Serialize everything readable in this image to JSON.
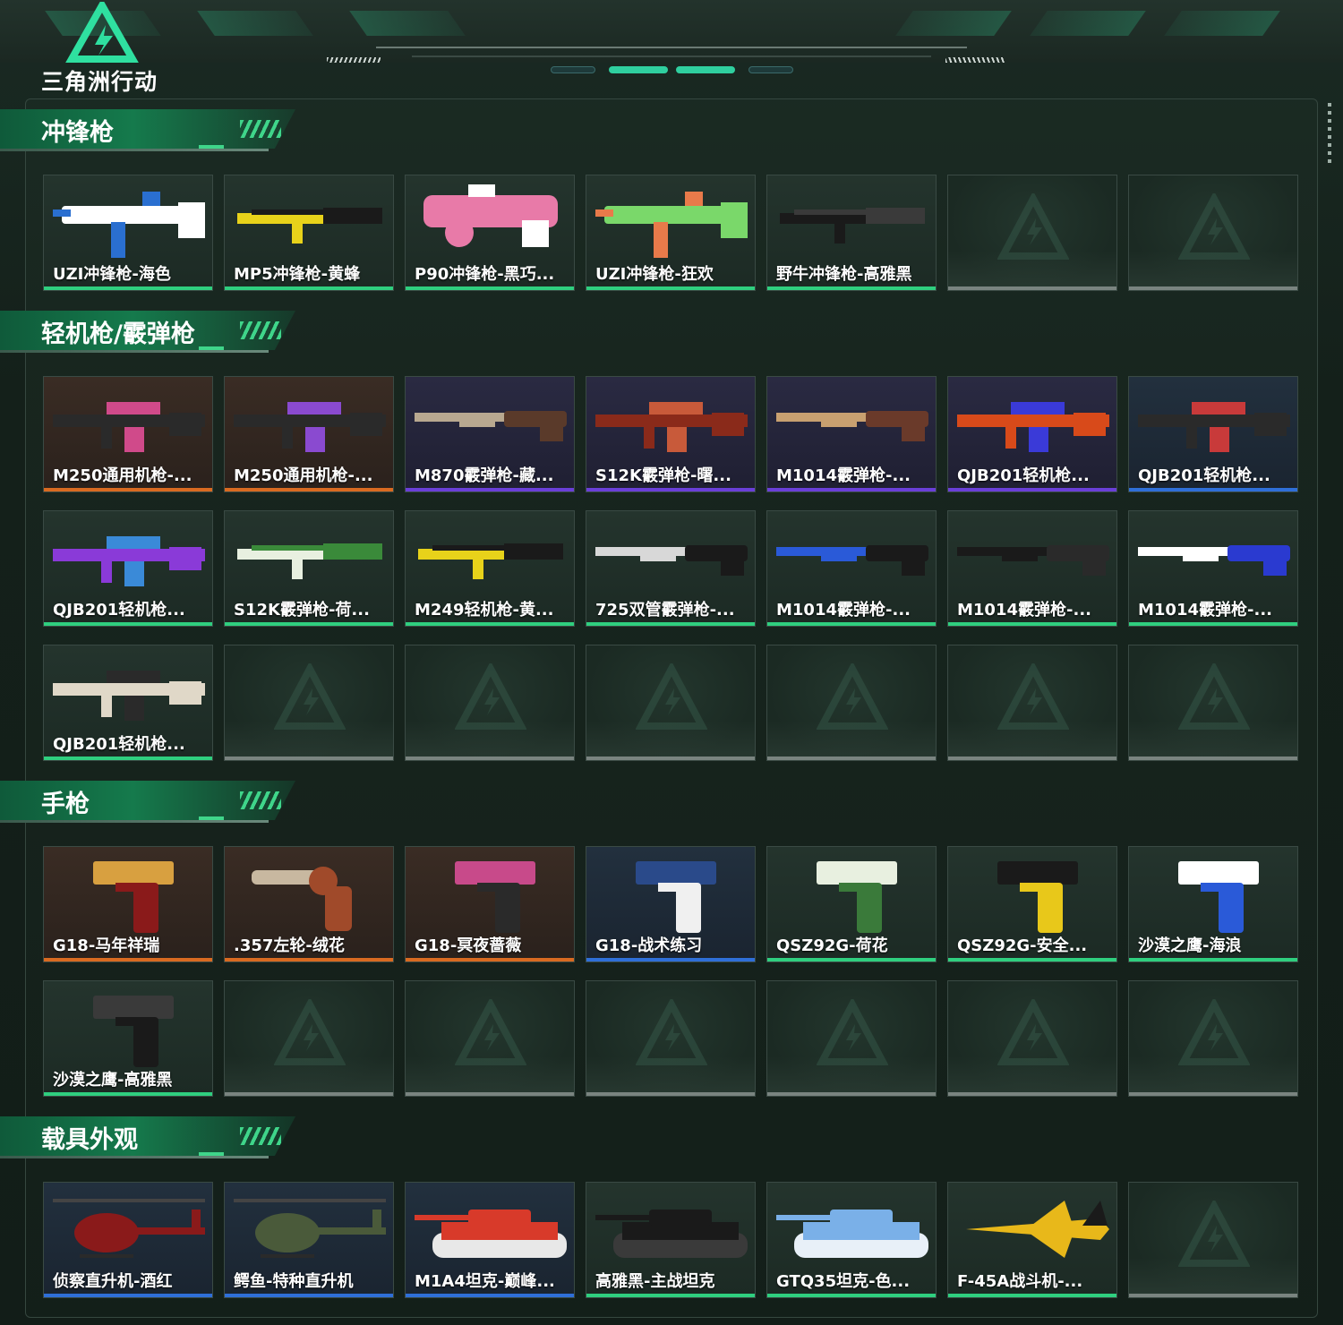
{
  "brand": {
    "logo_text": "三角洲行动",
    "accent": "#2fcf7f"
  },
  "rarity_colors": {
    "green": "#2fcf7f",
    "orange": "#d96a21",
    "purple": "#6a3fd8",
    "blue": "#2f6fd8",
    "empty": "#7a8480"
  },
  "sections": [
    {
      "title": "冲锋枪",
      "items": [
        {
          "label": "UZI冲锋枪-海色",
          "rarity": "green",
          "kind": "smg",
          "colors": [
            "#ffffff",
            "#2a6fd0"
          ]
        },
        {
          "label": "MP5冲锋枪-黄蜂",
          "rarity": "green",
          "kind": "rifle",
          "colors": [
            "#e8d21a",
            "#1a1a1a"
          ]
        },
        {
          "label": "P90冲锋枪-黑巧...",
          "rarity": "green",
          "kind": "p90",
          "colors": [
            "#e87aa8",
            "#ffffff"
          ]
        },
        {
          "label": "UZI冲锋枪-狂欢",
          "rarity": "green",
          "kind": "smg",
          "colors": [
            "#7ad86a",
            "#e87a4a"
          ]
        },
        {
          "label": "野牛冲锋枪-高雅黑",
          "rarity": "green",
          "kind": "rifle",
          "colors": [
            "#1a1a1a",
            "#3a3a3a"
          ]
        },
        {
          "label": "",
          "rarity": "empty"
        },
        {
          "label": "",
          "rarity": "empty"
        }
      ]
    },
    {
      "title": "轻机枪/霰弹枪",
      "items": [
        {
          "label": "M250通用机枪-...",
          "rarity": "orange",
          "kind": "lmg",
          "colors": [
            "#2a2a2a",
            "#d04a8a"
          ]
        },
        {
          "label": "M250通用机枪-...",
          "rarity": "orange",
          "kind": "lmg",
          "colors": [
            "#2a2a2a",
            "#8a4ad0"
          ]
        },
        {
          "label": "M870霰弹枪-藏...",
          "rarity": "purple",
          "kind": "shotgun",
          "colors": [
            "#b8a890",
            "#5a3a2a"
          ]
        },
        {
          "label": "S12K霰弹枪-曙...",
          "rarity": "purple",
          "kind": "lmg",
          "colors": [
            "#8a2a1a",
            "#c85a3a"
          ]
        },
        {
          "label": "M1014霰弹枪-...",
          "rarity": "purple",
          "kind": "shotgun",
          "colors": [
            "#c8a070",
            "#6a3a2a"
          ]
        },
        {
          "label": "QJB201轻机枪...",
          "rarity": "purple",
          "kind": "lmg",
          "colors": [
            "#d84a1a",
            "#3a3ad8"
          ]
        },
        {
          "label": "QJB201轻机枪...",
          "rarity": "blue",
          "kind": "lmg",
          "colors": [
            "#2a2a2a",
            "#c83a3a"
          ]
        },
        {
          "label": "QJB201轻机枪...",
          "rarity": "green",
          "kind": "lmg",
          "colors": [
            "#8a3ad8",
            "#3a8ad8"
          ]
        },
        {
          "label": "S12K霰弹枪-荷...",
          "rarity": "green",
          "kind": "rifle",
          "colors": [
            "#e8f0e0",
            "#3a8a3a"
          ]
        },
        {
          "label": "M249轻机枪-黄...",
          "rarity": "green",
          "kind": "rifle",
          "colors": [
            "#e8d21a",
            "#1a1a1a"
          ]
        },
        {
          "label": "725双管霰弹枪-...",
          "rarity": "green",
          "kind": "shotgun",
          "colors": [
            "#d8d8d8",
            "#1a1a1a"
          ]
        },
        {
          "label": "M1014霰弹枪-...",
          "rarity": "green",
          "kind": "shotgun",
          "colors": [
            "#2a5ad8",
            "#1a1a1a"
          ]
        },
        {
          "label": "M1014霰弹枪-...",
          "rarity": "green",
          "kind": "shotgun",
          "colors": [
            "#1a1a1a",
            "#2a2a2a"
          ]
        },
        {
          "label": "M1014霰弹枪-...",
          "rarity": "green",
          "kind": "shotgun",
          "colors": [
            "#ffffff",
            "#2a3ad0"
          ]
        },
        {
          "label": "QJB201轻机枪...",
          "rarity": "green",
          "kind": "lmg",
          "colors": [
            "#e0d8c8",
            "#2a2a2a"
          ]
        },
        {
          "label": "",
          "rarity": "empty"
        },
        {
          "label": "",
          "rarity": "empty"
        },
        {
          "label": "",
          "rarity": "empty"
        },
        {
          "label": "",
          "rarity": "empty"
        },
        {
          "label": "",
          "rarity": "empty"
        },
        {
          "label": "",
          "rarity": "empty"
        }
      ]
    },
    {
      "title": "手枪",
      "items": [
        {
          "label": "G18-马年祥瑞",
          "rarity": "orange",
          "kind": "pistol",
          "colors": [
            "#8a1a1a",
            "#d8a040"
          ]
        },
        {
          "label": ".357左轮-绒花",
          "rarity": "orange",
          "kind": "revolver",
          "colors": [
            "#c8b8a0",
            "#a04a2a"
          ]
        },
        {
          "label": "G18-冥夜蔷薇",
          "rarity": "orange",
          "kind": "pistol",
          "colors": [
            "#2a2a2a",
            "#c84a8a"
          ]
        },
        {
          "label": "G18-战术练习",
          "rarity": "blue",
          "kind": "pistol",
          "colors": [
            "#f0f0f0",
            "#2a4a8a"
          ]
        },
        {
          "label": "QSZ92G-荷花",
          "rarity": "green",
          "kind": "pistol",
          "colors": [
            "#3a7a3a",
            "#e8f0e0"
          ]
        },
        {
          "label": "QSZ92G-安全...",
          "rarity": "green",
          "kind": "pistol",
          "colors": [
            "#e8c81a",
            "#1a1a1a"
          ]
        },
        {
          "label": "沙漠之鹰-海浪",
          "rarity": "green",
          "kind": "pistol",
          "colors": [
            "#2a5ad8",
            "#ffffff"
          ]
        },
        {
          "label": "沙漠之鹰-高雅黑",
          "rarity": "green",
          "kind": "pistol",
          "colors": [
            "#1a1a1a",
            "#3a3a3a"
          ]
        },
        {
          "label": "",
          "rarity": "empty"
        },
        {
          "label": "",
          "rarity": "empty"
        },
        {
          "label": "",
          "rarity": "empty"
        },
        {
          "label": "",
          "rarity": "empty"
        },
        {
          "label": "",
          "rarity": "empty"
        },
        {
          "label": "",
          "rarity": "empty"
        }
      ]
    },
    {
      "title": "载具外观",
      "items": [
        {
          "label": "侦察直升机-酒红",
          "rarity": "blue",
          "kind": "heli",
          "colors": [
            "#8a1a1a",
            "#2a2a2a"
          ]
        },
        {
          "label": "鳄鱼-特种直升机",
          "rarity": "blue",
          "kind": "heli",
          "colors": [
            "#4a5a3a",
            "#2a2a2a"
          ]
        },
        {
          "label": "M1A4坦克-巅峰...",
          "rarity": "blue",
          "kind": "tank",
          "colors": [
            "#d83a2a",
            "#e8e8e8"
          ]
        },
        {
          "label": "高雅黑-主战坦克",
          "rarity": "green",
          "kind": "tank",
          "colors": [
            "#1a1a1a",
            "#3a3a3a"
          ]
        },
        {
          "label": "GTQ35坦克-色...",
          "rarity": "green",
          "kind": "tank",
          "colors": [
            "#7ab0e8",
            "#e8f0f8"
          ]
        },
        {
          "label": "F-45A战斗机-...",
          "rarity": "green",
          "kind": "jet",
          "colors": [
            "#e8b81a",
            "#1a1a1a"
          ]
        },
        {
          "label": "",
          "rarity": "empty"
        }
      ]
    }
  ]
}
